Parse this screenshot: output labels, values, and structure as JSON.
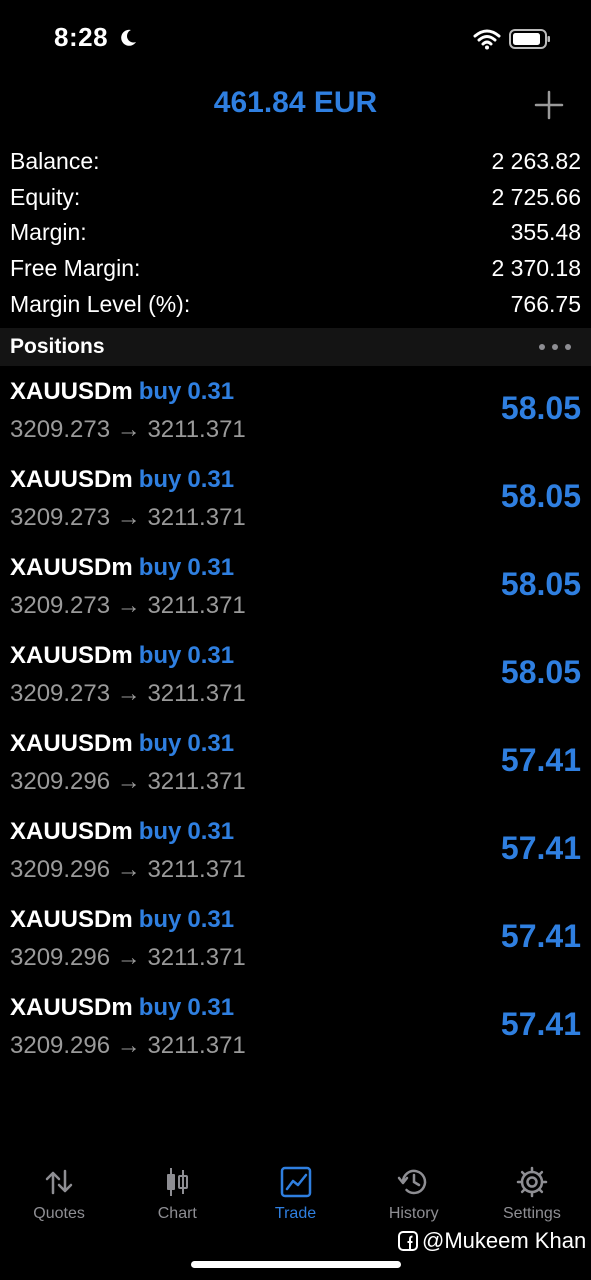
{
  "status_bar": {
    "time": "8:28"
  },
  "header": {
    "title": "461.84 EUR"
  },
  "summary": [
    {
      "label": "Balance:",
      "value": "2 263.82"
    },
    {
      "label": "Equity:",
      "value": "2 725.66"
    },
    {
      "label": "Margin:",
      "value": "355.48"
    },
    {
      "label": "Free Margin:",
      "value": "2 370.18"
    },
    {
      "label": "Margin Level (%):",
      "value": "766.75"
    }
  ],
  "positions": {
    "title": "Positions",
    "items": [
      {
        "symbol": "XAUUSDm",
        "direction": "buy",
        "volume": "0.31",
        "prices": "3209.273 → 3211.371",
        "profit": "58.05"
      },
      {
        "symbol": "XAUUSDm",
        "direction": "buy",
        "volume": "0.31",
        "prices": "3209.273 → 3211.371",
        "profit": "58.05"
      },
      {
        "symbol": "XAUUSDm",
        "direction": "buy",
        "volume": "0.31",
        "prices": "3209.273 → 3211.371",
        "profit": "58.05"
      },
      {
        "symbol": "XAUUSDm",
        "direction": "buy",
        "volume": "0.31",
        "prices": "3209.273 → 3211.371",
        "profit": "58.05"
      },
      {
        "symbol": "XAUUSDm",
        "direction": "buy",
        "volume": "0.31",
        "prices": "3209.296 → 3211.371",
        "profit": "57.41"
      },
      {
        "symbol": "XAUUSDm",
        "direction": "buy",
        "volume": "0.31",
        "prices": "3209.296 → 3211.371",
        "profit": "57.41"
      },
      {
        "symbol": "XAUUSDm",
        "direction": "buy",
        "volume": "0.31",
        "prices": "3209.296 → 3211.371",
        "profit": "57.41"
      },
      {
        "symbol": "XAUUSDm",
        "direction": "buy",
        "volume": "0.31",
        "prices": "3209.296 → 3211.371",
        "profit": "57.41"
      }
    ]
  },
  "tabs": [
    {
      "label": "Quotes",
      "icon": "quotes-icon",
      "active": false
    },
    {
      "label": "Chart",
      "icon": "chart-icon",
      "active": false
    },
    {
      "label": "Trade",
      "icon": "trade-icon",
      "active": true
    },
    {
      "label": "History",
      "icon": "history-icon",
      "active": false
    },
    {
      "label": "Settings",
      "icon": "settings-icon",
      "active": false
    }
  ],
  "watermark": {
    "text": "@Mukeem Khan"
  },
  "colors": {
    "accent": "#2f7fe0",
    "background": "#000000",
    "muted_text": "#9a9a9a",
    "tab_inactive": "#8e8e93"
  }
}
